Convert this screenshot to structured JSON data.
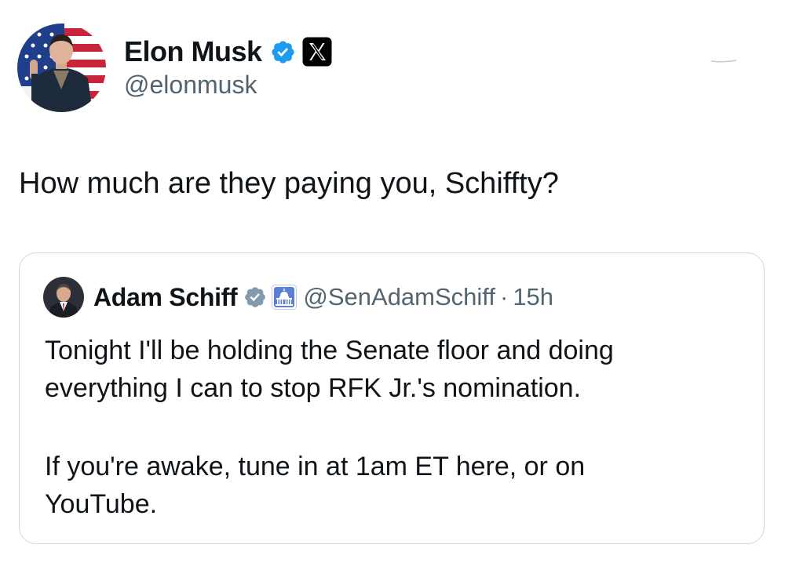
{
  "author": {
    "display_name": "Elon Musk",
    "handle": "@elonmusk",
    "verified": true,
    "affiliate_badge": "x-logo-icon",
    "badge_color": "#1d9bf0"
  },
  "tweet": {
    "text": "How much are they paying you, Schiffty?"
  },
  "quoted": {
    "display_name": "Adam Schiff",
    "handle": "@SenAdamSchiff",
    "separator": "·",
    "time": "15h",
    "verified": true,
    "affiliation_icon": "capitol-icon",
    "badge_color": "#829aab",
    "paragraphs": [
      "Tonight I'll be holding the Senate floor and doing",
      "everything I can to stop RFK Jr.'s nomination.",
      "If you're awake, tune in at 1am ET here, or on",
      "YouTube."
    ]
  },
  "colors": {
    "text_primary": "#0f1419",
    "text_secondary": "#536471",
    "border": "#cfd9de"
  }
}
